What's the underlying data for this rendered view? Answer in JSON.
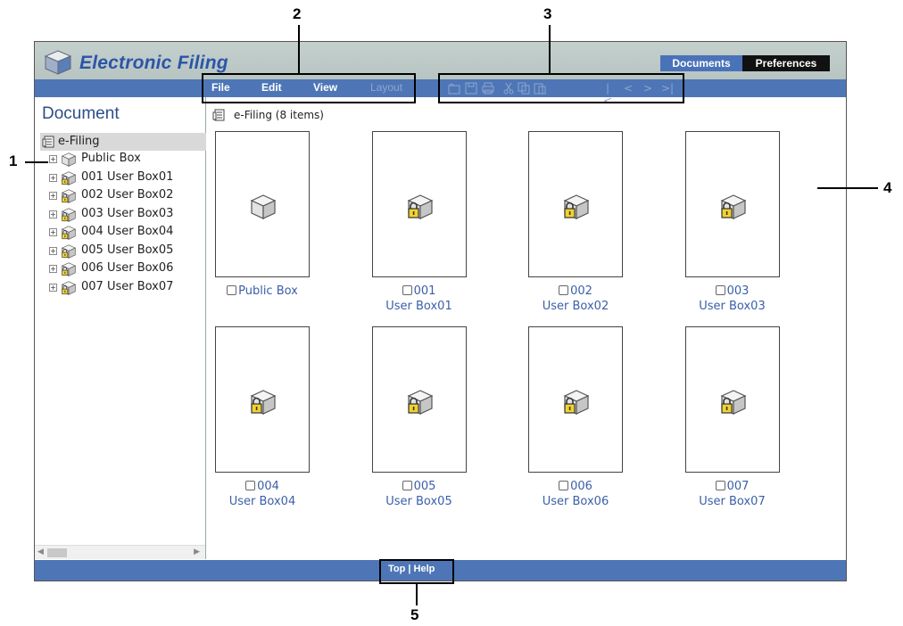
{
  "app": {
    "title": "Electronic Filing",
    "tabs": [
      {
        "label": "Documents",
        "active": true
      },
      {
        "label": "Preferences",
        "active": false
      }
    ]
  },
  "menu": {
    "items": [
      {
        "label": "File",
        "enabled": true
      },
      {
        "label": "Edit",
        "enabled": true
      },
      {
        "label": "View",
        "enabled": true
      },
      {
        "label": "Layout",
        "enabled": false
      }
    ],
    "toolbar_icons": [
      "new-folder-icon",
      "save-icon",
      "print-icon",
      "cut-icon",
      "copy-icon",
      "paste-icon",
      "first-page-icon",
      "previous-page-icon",
      "next-page-icon",
      "last-page-icon"
    ],
    "pager_glyphs": [
      "|<",
      "<",
      ">",
      ">|"
    ]
  },
  "sidebar": {
    "heading": "Document",
    "root": {
      "label": "e-Filing",
      "icon": "efiling-icon"
    },
    "items": [
      {
        "label": "Public Box",
        "icon": "open-box-icon",
        "locked": false
      },
      {
        "label": "001 User Box01",
        "icon": "locked-box-icon",
        "locked": true
      },
      {
        "label": "002 User Box02",
        "icon": "locked-box-icon",
        "locked": true
      },
      {
        "label": "003 User Box03",
        "icon": "locked-box-icon",
        "locked": true
      },
      {
        "label": "004 User Box04",
        "icon": "locked-box-icon",
        "locked": true
      },
      {
        "label": "005 User Box05",
        "icon": "locked-box-icon",
        "locked": true
      },
      {
        "label": "006 User Box06",
        "icon": "locked-box-icon",
        "locked": true
      },
      {
        "label": "007 User Box07",
        "icon": "locked-box-icon",
        "locked": true
      }
    ],
    "expander_glyph": "+"
  },
  "main": {
    "breadcrumb": "e-Filing  (8 items)",
    "boxes": [
      {
        "line1": "Public Box",
        "line2": "",
        "locked": false
      },
      {
        "line1": "001",
        "line2": "User Box01",
        "locked": true
      },
      {
        "line1": "002",
        "line2": "User Box02",
        "locked": true
      },
      {
        "line1": "003",
        "line2": "User Box03",
        "locked": true
      },
      {
        "line1": "004",
        "line2": "User Box04",
        "locked": true
      },
      {
        "line1": "005",
        "line2": "User Box05",
        "locked": true
      },
      {
        "line1": "006",
        "line2": "User Box06",
        "locked": true
      },
      {
        "line1": "007",
        "line2": "User Box07",
        "locked": true
      }
    ]
  },
  "footer": {
    "top": "Top",
    "separator": "|",
    "help": "Help"
  },
  "callouts": [
    "1",
    "2",
    "3",
    "4",
    "5"
  ],
  "colors": {
    "accent": "#4e76b6",
    "title": "#2c55a8",
    "link": "#3a5fa8",
    "header_bg": "#bcc8c5"
  }
}
